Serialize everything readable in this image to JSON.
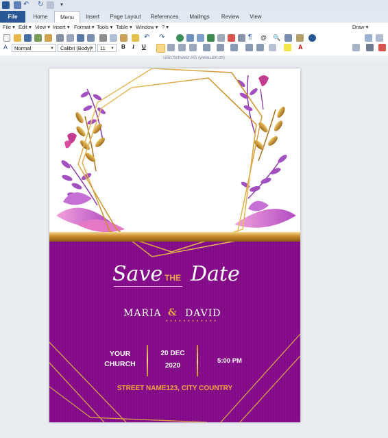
{
  "quick_access": {
    "icons": [
      "word-icon",
      "save-icon",
      "undo-icon",
      "redo-icon",
      "print-preview-icon",
      "customize-icon"
    ]
  },
  "tabs": [
    {
      "label": "File"
    },
    {
      "label": "Home"
    },
    {
      "label": "Menu"
    },
    {
      "label": "Insert"
    },
    {
      "label": "Page Layout"
    },
    {
      "label": "References"
    },
    {
      "label": "Mailings"
    },
    {
      "label": "Review"
    },
    {
      "label": "View"
    }
  ],
  "classic_menu": [
    "File",
    "Edit",
    "View",
    "Insert",
    "Format",
    "Tools",
    "Table",
    "Window",
    "?"
  ],
  "right_menu": {
    "draw": "Draw"
  },
  "formatting": {
    "style": "Normal",
    "font": "Calibri (Body)",
    "size": "11",
    "bold": "B",
    "italic": "I",
    "underline": "U"
  },
  "watermark_bar": "UBit Schweiz AG (www.ubit.ch)",
  "card": {
    "save": "Save",
    "the": "THE",
    "date": "Date",
    "name1": "MARIA",
    "amp": "&",
    "name2": "DAVID",
    "dots": "• • • • • • • • • • • •",
    "venue_l1": "YOUR",
    "venue_l2": "CHURCH",
    "day": "20 DEC",
    "year": "2020",
    "time": "5:00 PM",
    "address": "STREET NAME123, CITY COUNTRY"
  },
  "colors": {
    "purple": "#820d87",
    "gold": "#d4a24a",
    "accent": "#e8a54a",
    "ribbon_blue": "#2b5797"
  }
}
